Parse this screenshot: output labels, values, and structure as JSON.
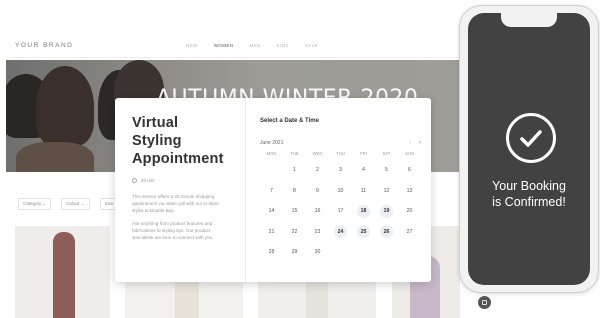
{
  "site": {
    "brand": "YOUR BRAND",
    "nav": [
      "NEW",
      "WOMEN",
      "MEN",
      "KIDS",
      "SALE"
    ],
    "hero_title": "AUTUMN WINTER 2020",
    "filters": [
      "Category ⌄",
      "Colour ⌄",
      "Size ⌄"
    ]
  },
  "booking": {
    "title_line1": "Virtual Styling",
    "title_line2": "Appointment",
    "duration": "30 min",
    "description_1": "This service offers a 30 minute shopping appointment via video call with our in-store stylist at Double Bay.",
    "description_2": "Ask anything from product features and fabrications to styling tips. Our product specialists are here to connect with you.",
    "select_title": "Select a Date & Time",
    "month": "June 2021",
    "prev_arrow": "‹",
    "next_arrow": "›",
    "weekdays": [
      "MON",
      "TUE",
      "WED",
      "THU",
      "FRI",
      "SAT",
      "SUN"
    ],
    "days": [
      {
        "label": "",
        "available": false
      },
      {
        "label": "1",
        "available": false
      },
      {
        "label": "2",
        "available": false
      },
      {
        "label": "3",
        "available": false
      },
      {
        "label": "4",
        "available": false
      },
      {
        "label": "5",
        "available": false
      },
      {
        "label": "6",
        "available": false
      },
      {
        "label": "7",
        "available": false
      },
      {
        "label": "8",
        "available": false
      },
      {
        "label": "9",
        "available": false
      },
      {
        "label": "10",
        "available": false
      },
      {
        "label": "11",
        "available": false
      },
      {
        "label": "12",
        "available": false
      },
      {
        "label": "13",
        "available": false
      },
      {
        "label": "14",
        "available": false
      },
      {
        "label": "15",
        "available": false
      },
      {
        "label": "16",
        "available": false
      },
      {
        "label": "17",
        "available": false
      },
      {
        "label": "18",
        "available": true
      },
      {
        "label": "19",
        "available": true
      },
      {
        "label": "20",
        "available": false
      },
      {
        "label": "21",
        "available": false
      },
      {
        "label": "22",
        "available": false
      },
      {
        "label": "23",
        "available": false
      },
      {
        "label": "24",
        "available": true
      },
      {
        "label": "25",
        "available": true
      },
      {
        "label": "26",
        "available": true
      },
      {
        "label": "27",
        "available": false
      },
      {
        "label": "28",
        "available": false
      },
      {
        "label": "29",
        "available": false
      },
      {
        "label": "30",
        "available": false
      }
    ]
  },
  "phone": {
    "confirm_line1": "Your Booking",
    "confirm_line2": "is Confirmed!"
  },
  "colors": {
    "phone_screen": "#424242",
    "available_day_bg": "#eceef4"
  }
}
